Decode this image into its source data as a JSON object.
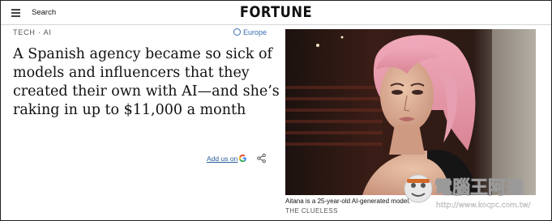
{
  "header": {
    "search_label": "Search",
    "logo_text": "FORTUNE"
  },
  "article": {
    "section": "TECH · AI",
    "edition": "Europe",
    "headline": "A Spanish agency became so sick of models and influencers that they created their own with AI—and she’s raking in up to $11,000 a month",
    "add_us_label": "Add us on"
  },
  "image": {
    "caption": "Aitana is a 25-year-old AI-generated model.",
    "credit": "THE CLUELESS"
  },
  "watermark": {
    "brand": "電腦王阿達",
    "url": "http://www.kocpc.com.tw/"
  },
  "icons": {
    "menu": "hamburger-menu-icon",
    "globe": "globe-icon",
    "google": "google-g-icon",
    "share": "share-icon"
  },
  "colors": {
    "accent_link": "#2c5d9a",
    "edition_blue": "#3a6fb0",
    "hair_pink": "#e59aab"
  }
}
